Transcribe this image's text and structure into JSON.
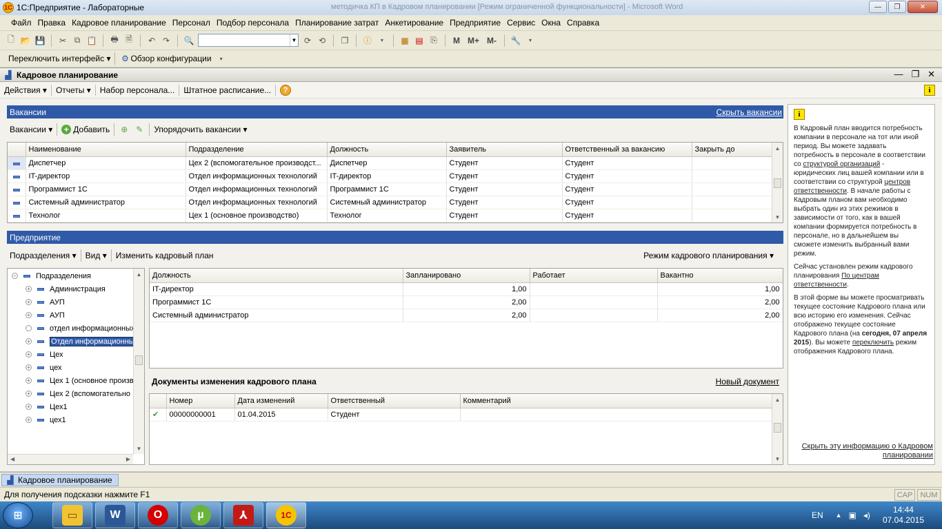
{
  "window": {
    "title": "1С:Предприятие - Лабораторные",
    "background_title": "методичка КП в Кадровом планировании [Режим ограниченной функциональности] - Microsoft Word"
  },
  "menu": [
    "Файл",
    "Правка",
    "Кадровое планирование",
    "Персонал",
    "Подбор персонала",
    "Планирование затрат",
    "Анкетирование",
    "Предприятие",
    "Сервис",
    "Окна",
    "Справка"
  ],
  "toolbar": {
    "memory_buttons": [
      "M",
      "M+",
      "M-"
    ]
  },
  "toolbar2": {
    "switch_interface": "Переключить интерфейс",
    "config_overview": "Обзор конфигурации"
  },
  "form": {
    "title": "Кадровое планирование",
    "commands": [
      "Действия",
      "Отчеты",
      "Набор персонала...",
      "Штатное расписание..."
    ]
  },
  "vacancies": {
    "header": "Вакансии",
    "hide_link": "Скрыть вакансии",
    "menu_label": "Вакансии",
    "add_label": "Добавить",
    "sort_label": "Упорядочить вакансии",
    "columns": [
      "Наименование",
      "Подразделение",
      "Должность",
      "Заявитель",
      "Ответственный за вакансию",
      "Закрыть до"
    ],
    "rows": [
      [
        "Диспетчер",
        "Цех 2 (вспомогательное производст...",
        "Диспетчер",
        "Студент",
        "Студент",
        ""
      ],
      [
        "IT-директор",
        "Отдел информационных технологий",
        "IT-директор",
        "Студент",
        "Студент",
        ""
      ],
      [
        "Программист  1С",
        "Отдел информационных технологий",
        "Программист 1С",
        "Студент",
        "Студент",
        ""
      ],
      [
        "Системный администратор",
        "Отдел информационных технологий",
        "Системный администратор",
        "Студент",
        "Студент",
        ""
      ],
      [
        "Технолог",
        "Цех 1 (основное производство)",
        "Технолог",
        "Студент",
        "Студент",
        ""
      ]
    ]
  },
  "enterprise": {
    "header": "Предприятие",
    "departments_label": "Подразделения",
    "view_label": "Вид",
    "change_plan_label": "Изменить кадровый план",
    "mode_label": "Режим кадрового планирования",
    "tree_root": "Подразделения",
    "tree": [
      "Администрация",
      "АУП",
      "АУП",
      "отдел информационных",
      "Отдел информационны",
      "Цех",
      "цех",
      "Цех 1 (основное произв",
      "Цех 2 (вспомогательно",
      "Цех1",
      "цех1"
    ],
    "plan_columns": [
      "Должность",
      "Запланировано",
      "Работает",
      "Вакантно"
    ],
    "plan_rows": [
      [
        "IT-директор",
        "1,00",
        "",
        "1,00"
      ],
      [
        "Программист 1С",
        "2,00",
        "",
        "2,00"
      ],
      [
        "Системный администратор",
        "2,00",
        "",
        "2,00"
      ]
    ]
  },
  "documents": {
    "header": "Документы изменения кадрового плана",
    "new_link": "Новый документ",
    "columns": [
      "Номер",
      "Дата изменений",
      "Ответственный",
      "Комментарий"
    ],
    "rows": [
      [
        "00000000001",
        "01.04.2015",
        "Студент",
        ""
      ]
    ]
  },
  "info": {
    "p1_a": "В Кадровый план вводится потребность компании в персонале на тот или иной период. Вы можете задавать потребность в персонале в соответствии со ",
    "p1_link1": "структурой организаций",
    "p1_b": " - юридических лиц вашей компании или в соответствии со структурой ",
    "p1_link2": "центров ответственности",
    "p1_c": ". В начале работы с Кадровым планом вам необходимо выбрать один из этих режимов в зависимости от того, как в вашей компании формируется потребность в персонале, но в дальнейшем вы сможете изменить выбранный вами режим.",
    "p2_a": "Сейчас установлен режим кадрового планирования ",
    "p2_link": "По центрам ответственности",
    "p2_b": ".",
    "p3_a": "В этой форме вы можете просматривать текущее состояние Кадрового плана или всю историю его изменения. Сейчас отображено текущее состояние Кадрового плана (на ",
    "p3_bold": "сегодня, 07 апреля 2015",
    "p3_b": "). Вы можете ",
    "p3_link": "переключить",
    "p3_c": " режим отображения Кадрового плана.",
    "hide_link": "Скрыть эту информацию о Кадровом планировании"
  },
  "window_tab": "Кадровое планирование",
  "status": {
    "hint": "Для получения подсказки нажмите F1",
    "cap": "CAP",
    "num": "NUM"
  },
  "taskbar": {
    "lang": "EN",
    "time": "14:44",
    "date": "07.04.2015"
  },
  "colors": {
    "section_blue": "#2f5aa8",
    "accent_orange": "#f0a830"
  }
}
